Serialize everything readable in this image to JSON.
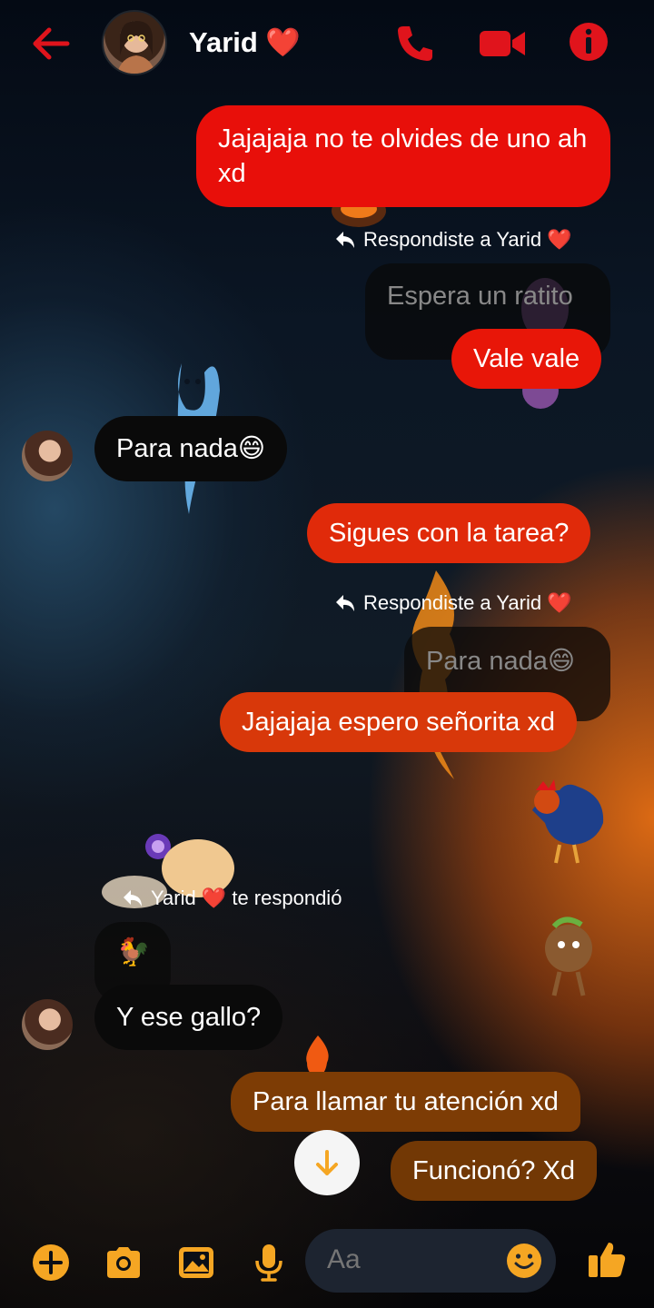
{
  "header": {
    "contact_name": "Yarid ❤️",
    "back_icon": "back-arrow-icon",
    "call_icon": "phone-icon",
    "video_icon": "video-camera-icon",
    "info_icon": "info-icon"
  },
  "colors": {
    "accent": "#e0141c",
    "tool_accent": "#f5a623",
    "sent_red": "#e80f0a",
    "sent_orange_red": "#d8350a",
    "sent_brown": "#7a3b05",
    "received": "#0a0a0a"
  },
  "messages": [
    {
      "id": "m1",
      "direction": "sent",
      "text": "Jajajaja no te olvides de uno ah xd"
    },
    {
      "id": "m2",
      "direction": "sent",
      "reply_meta": "Respondiste a Yarid ❤️",
      "quoted": "Espera un ratito",
      "text": "Vale vale"
    },
    {
      "id": "m3",
      "direction": "received",
      "text": "Para nada😄"
    },
    {
      "id": "m4",
      "direction": "sent",
      "text": "Sigues con la tarea?"
    },
    {
      "id": "m5",
      "direction": "sent",
      "reply_meta": "Respondiste a Yarid ❤️",
      "quoted": "Para nada😄",
      "text": "Jajajaja espero señorita xd"
    },
    {
      "id": "m6",
      "direction": "received",
      "reply_meta": "Yarid ❤️ te respondió",
      "quoted": "🐓",
      "text": "Y ese gallo?"
    },
    {
      "id": "m7",
      "direction": "sent",
      "text": "Para llamar tu atención xd"
    },
    {
      "id": "m8",
      "direction": "sent",
      "text": "Funcionó? Xd"
    }
  ],
  "composer": {
    "placeholder": "Aa",
    "tools": [
      "plus-icon",
      "camera-icon",
      "image-icon",
      "microphone-icon"
    ],
    "emoji_icon": "smiley-icon",
    "like_icon": "thumbs-up-icon"
  },
  "scroll_down_icon": "arrow-down-icon"
}
